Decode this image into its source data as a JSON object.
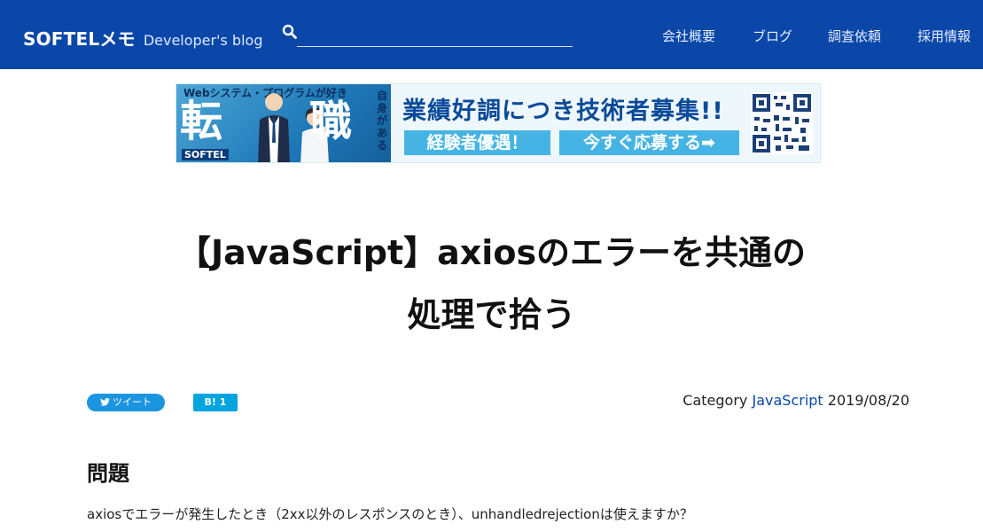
{
  "header": {
    "logo": "SOFTELメモ",
    "tagline": "Developer's blog",
    "search": {
      "value": "",
      "placeholder": ""
    },
    "nav": [
      "会社概要",
      "ブログ",
      "調査依頼",
      "採用情報"
    ]
  },
  "banner": {
    "top_text": "Webシステム・プログラムが好き",
    "side_text": "自身がある",
    "char1": "転",
    "char2": "職",
    "logo": "SOFTEL",
    "headline": "業績好調につき技術者募集!!",
    "button1": "経験者優遇！",
    "button2": "今すぐ応募する➡"
  },
  "article": {
    "title_line1": "【JavaScript】axiosのエラーを共通の",
    "title_line2": "処理で拾う",
    "tweet_label": "ツイート",
    "hatena_label": "B! 1",
    "category_label": "Category",
    "category": "JavaScript",
    "date": "2019/08/20",
    "section_heading": "問題",
    "paragraph": "axiosでエラーが発生したとき（2xx以外のレスポンスのとき）、unhandledrejectionは使えますか？"
  },
  "colors": {
    "header_bg": "#0a47a9",
    "link": "#0a47a9",
    "tweet": "#1b95e0",
    "hatena": "#00a4de",
    "banner_button": "#45b4e4"
  }
}
